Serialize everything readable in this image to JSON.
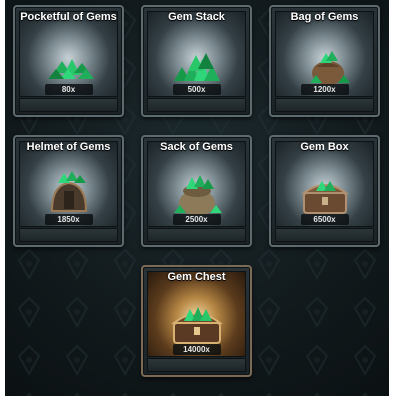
{
  "shop": {
    "items": [
      {
        "title": "Pocketful of Gems",
        "price": "80x",
        "icon": "gem-pile-icon"
      },
      {
        "title": "Gem Stack",
        "price": "500x",
        "icon": "gem-stack-icon"
      },
      {
        "title": "Bag of Gems",
        "price": "1200x",
        "icon": "gem-bag-icon"
      },
      {
        "title": "Helmet of Gems",
        "price": "1850x",
        "icon": "gem-helmet-icon"
      },
      {
        "title": "Sack of Gems",
        "price": "2500x",
        "icon": "gem-sack-icon"
      },
      {
        "title": "Gem Box",
        "price": "6500x",
        "icon": "gem-box-icon"
      },
      {
        "title": "Gem Chest",
        "price": "14000x",
        "icon": "gem-chest-icon"
      }
    ]
  },
  "colors": {
    "gem_green": "#1fae5a",
    "tile_border": "#5d6a6f",
    "chest_glow": "#f3dba9"
  }
}
